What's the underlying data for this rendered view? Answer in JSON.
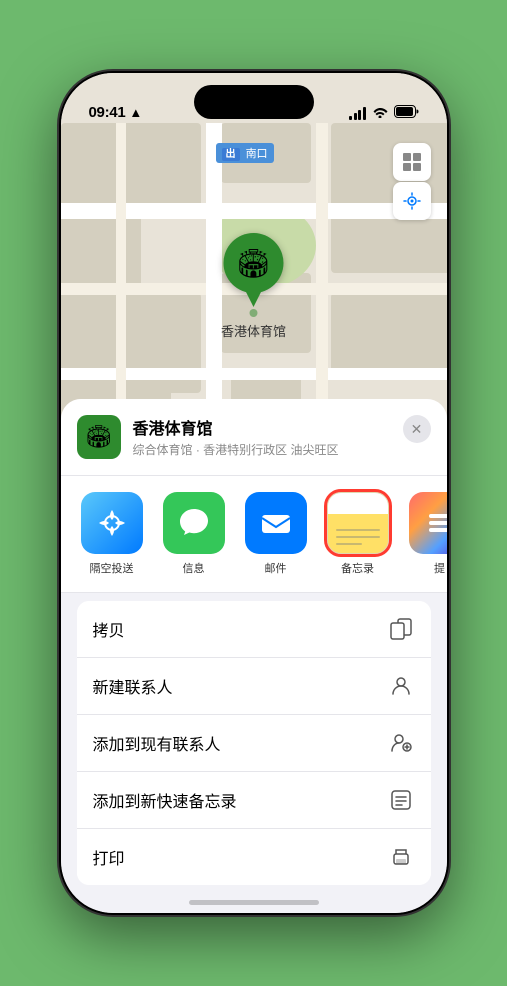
{
  "status_bar": {
    "time": "09:41",
    "location_arrow": "▶"
  },
  "map": {
    "label": "南口",
    "pin_label": "香港体育馆"
  },
  "venue_card": {
    "name": "香港体育馆",
    "subtitle": "综合体育馆 · 香港特别行政区 油尖旺区",
    "close_label": "✕"
  },
  "share_items": [
    {
      "id": "airdrop",
      "label": "隔空投送",
      "type": "airdrop"
    },
    {
      "id": "messages",
      "label": "信息",
      "type": "messages"
    },
    {
      "id": "mail",
      "label": "邮件",
      "type": "mail"
    },
    {
      "id": "notes",
      "label": "备忘录",
      "type": "notes",
      "selected": true
    },
    {
      "id": "more",
      "label": "提",
      "type": "more"
    }
  ],
  "action_items": [
    {
      "id": "copy",
      "label": "拷贝",
      "icon": "copy"
    },
    {
      "id": "new-contact",
      "label": "新建联系人",
      "icon": "person"
    },
    {
      "id": "add-existing",
      "label": "添加到现有联系人",
      "icon": "person-add"
    },
    {
      "id": "add-notes",
      "label": "添加到新快速备忘录",
      "icon": "notes"
    },
    {
      "id": "print",
      "label": "打印",
      "icon": "printer"
    }
  ]
}
